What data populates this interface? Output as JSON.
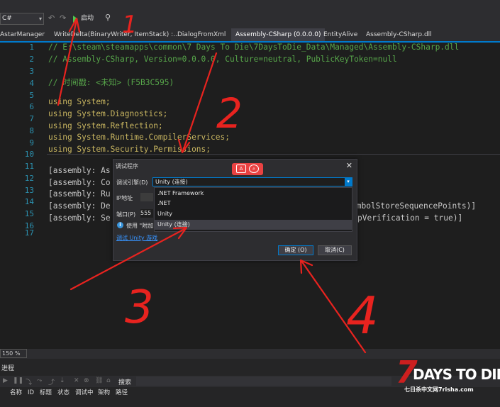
{
  "toolbar": {
    "language": "C#",
    "start_label": "启动"
  },
  "tabs": [
    {
      "label": "AstarManager"
    },
    {
      "label": "WriteDelta(BinaryWriter, ItemStack) :..."
    },
    {
      "label": "DialogFromXml"
    },
    {
      "label": "Assembly-CSharp (0.0.0.0)"
    },
    {
      "label": "EntityAlive"
    },
    {
      "label": "Assembly-CSharp.dll"
    }
  ],
  "editor": {
    "line_numbers": [
      "1",
      "2",
      "3",
      "4",
      "5",
      "6",
      "7",
      "8",
      "9",
      "10",
      "11",
      "12",
      "13",
      "14",
      "15",
      "16",
      "17"
    ],
    "lines": {
      "l1": "// E:\\steam\\steamapps\\common\\7 Days To Die\\7DaysToDie_Data\\Managed\\Assembly-CSharp.dll",
      "l2": "// Assembly-CSharp, Version=0.0.0.0, Culture=neutral, PublicKeyToken=null",
      "l4": "// 时间戳: <未知> (F5B3C595)",
      "l6_kw": "using",
      "l6_ns": " System;",
      "l7_kw": "using",
      "l7_ns": " System.Diagnostics;",
      "l8_kw": "using",
      "l8_ns": " System.Reflection;",
      "l9_kw": "using",
      "l9_ns": " System.Runtime.CompilerServices;",
      "l10_kw": "using",
      "l10_ns": " System.Security.Permissions;",
      "l12": "[assembly: As",
      "l13": "[assembly: Co",
      "l14": "[assembly: Ru",
      "l15": "[assembly: De",
      "l15_tail": "ymbolStoreSequencePoints)]",
      "l16": "[assembly: Se",
      "l16_tail": "pVerification = true)]"
    }
  },
  "dialog": {
    "title": "调试程序",
    "engine_label": "调试引擎(D)",
    "engine_value": "Unity (连接)",
    "options": [
      ".NET Framework",
      ".NET",
      "Unity",
      "Unity (连接)"
    ],
    "selected_option": "Unity (连接)",
    "ip_label": "IP地址",
    "port_label": "端口(P)",
    "port_value": "555",
    "info_text": "使用 \"附加",
    "link_text": "调试 Unity 游戏",
    "ok_label": "确定 (O)",
    "cancel_label": "取消(C)"
  },
  "status": {
    "zoom": "150 %"
  },
  "bottom_panel": {
    "title": "进程",
    "search_label": "搜索",
    "columns": [
      "名称",
      "ID",
      "标题",
      "状态",
      "调试中",
      "架构",
      "路径"
    ]
  },
  "watermark": {
    "logo_number": "7",
    "logo_text": "DAYS TO DIE",
    "subtitle": "七日杀中文网7risha.com"
  },
  "annotations": {
    "numbers": [
      "1",
      "2",
      "3",
      "4"
    ],
    "color": "#e8231f"
  },
  "colors": {
    "accent": "#007acc",
    "comment": "#57a64a",
    "keyword": "#c8b560",
    "line_number": "#2b91af",
    "watermark_red": "#cc1f1f"
  }
}
